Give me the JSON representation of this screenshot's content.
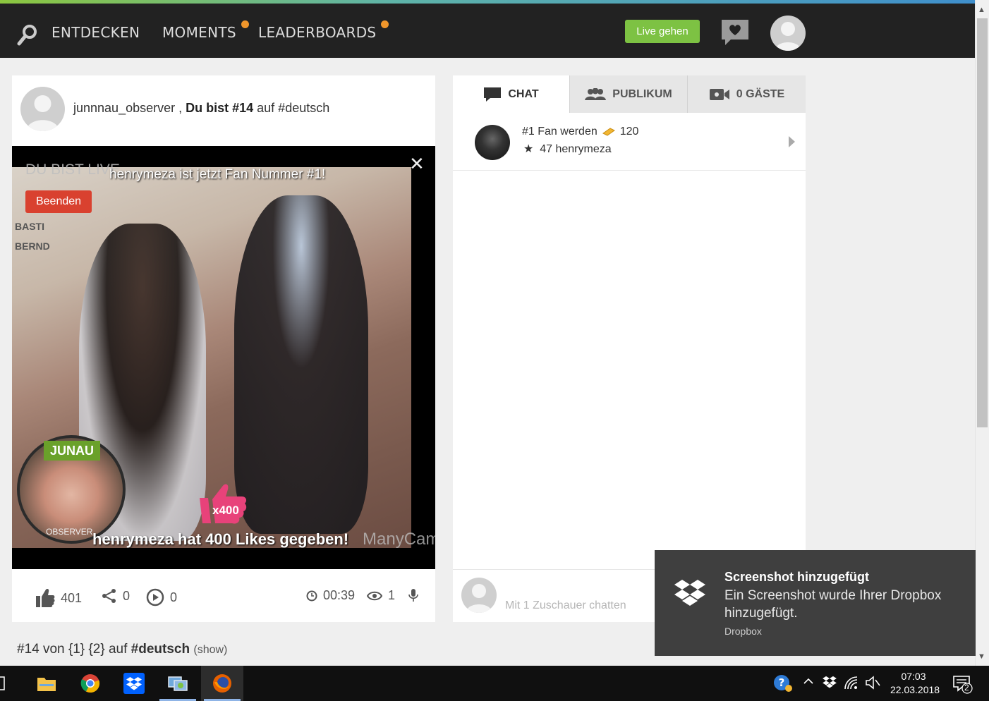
{
  "nav": {
    "links": [
      "ENTDECKEN",
      "MOMENTS",
      "LEADERBOARDS"
    ],
    "live_button": "Live gehen"
  },
  "host": {
    "username": "junnnau_observer",
    "separator": " , ",
    "rank_bold": "Du bist #14",
    "rank_rest": " auf #deutsch"
  },
  "video": {
    "live_label": "DU BIST LIVE",
    "fan_banner": "henrymeza ist jetzt Fan Nummer #1!",
    "end_button": "Beenden",
    "sign_lines": [
      "BASTI",
      "BERND"
    ],
    "cam_label_top": "JUNAU",
    "cam_label_bottom": "OBSERVER",
    "likes_multiplier": "x400",
    "likes_banner": "henrymeza hat 400 Likes gegeben!",
    "watermark": "ManyCam"
  },
  "stats": {
    "likes": "401",
    "shares": "0",
    "replays": "0",
    "duration": "00:39",
    "viewers": "1"
  },
  "rank_footer": {
    "rank": "#14",
    "middle": " von {1} {2} auf ",
    "tag": "#deutsch",
    "show": "(show)"
  },
  "chat_panel": {
    "tabs": [
      {
        "label": "CHAT",
        "icon": "chat-bubble-icon"
      },
      {
        "label": "PUBLIKUM",
        "icon": "people-icon"
      },
      {
        "label": "0 GÄSTE",
        "icon": "video-camera-icon"
      }
    ],
    "fan_row": {
      "title": "#1 Fan werden",
      "coins": "120",
      "star_count": "47",
      "leader": "henrymeza"
    },
    "input_placeholder": "Mit 1 Zuschauer chatten"
  },
  "toast": {
    "title": "Screenshot hinzugefügt",
    "body": "Ein Screenshot wurde Ihrer Dropbox hinzugefügt.",
    "app": "Dropbox"
  },
  "taskbar": {
    "apps": [
      "file-explorer-icon",
      "chrome-icon",
      "dropbox-icon",
      "network-app-icon",
      "firefox-icon"
    ],
    "time": "07:03",
    "date": "22.03.2018",
    "notifications": "2"
  },
  "colors": {
    "accent_green": "#7dc243",
    "danger_red": "#d9412f",
    "likes_pink": "#e8427a",
    "nav_dot": "#f0962b"
  }
}
